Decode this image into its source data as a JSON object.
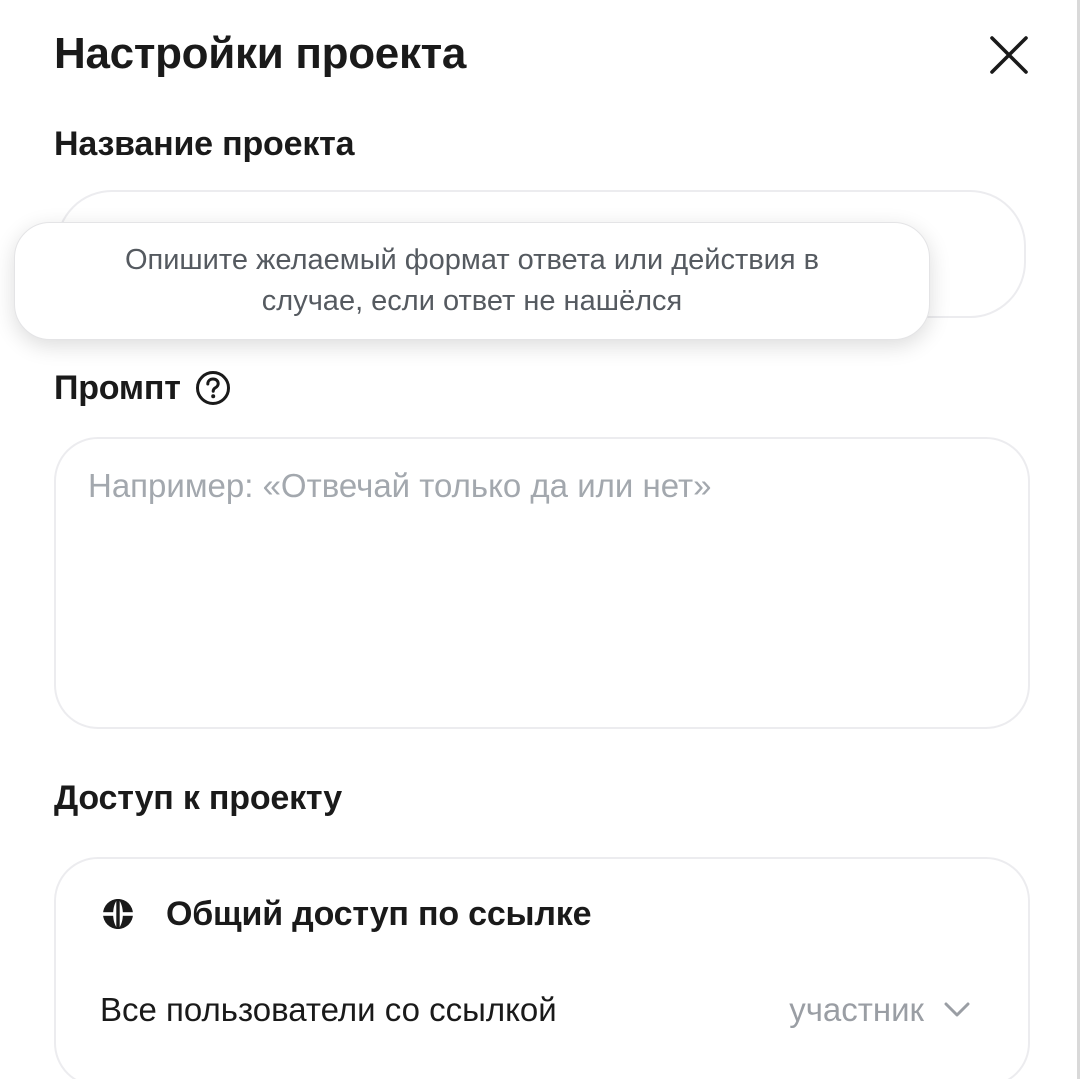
{
  "header": {
    "title": "Настройки проекта",
    "close_icon": "close-icon"
  },
  "project_name": {
    "label": "Название проекта",
    "value": ""
  },
  "tooltip": {
    "text": "Опишите желаемый формат ответа или действия в случае, если ответ не нашёлся"
  },
  "prompt": {
    "label": "Промпт",
    "help_icon": "question-circle-icon",
    "placeholder": "Например: «Отвечай только да или нет»"
  },
  "access": {
    "label": "Доступ к проекту",
    "share": {
      "icon": "globe-icon",
      "title": "Общий доступ по ссылке",
      "users_label": "Все пользователи со ссылкой",
      "role_selected": "участник",
      "chevron_icon": "chevron-down-icon"
    }
  },
  "colors": {
    "text": "#1a1a1a",
    "placeholder": "#a3a8ae",
    "border": "#ececef",
    "tooltip_text": "#555a60"
  }
}
